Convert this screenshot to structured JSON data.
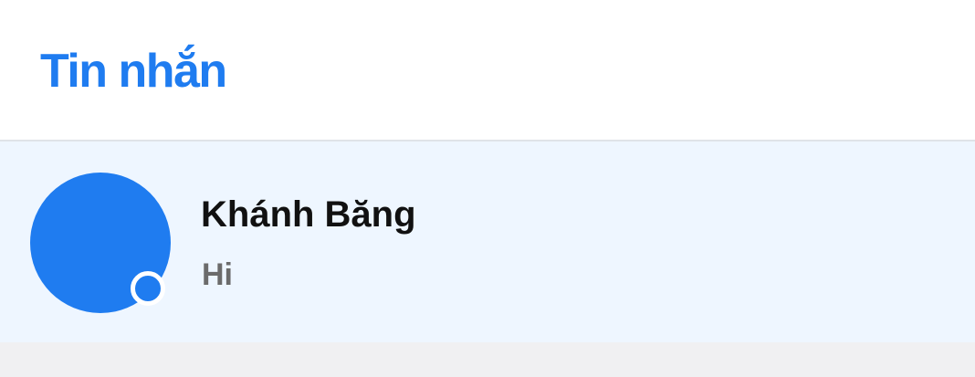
{
  "header": {
    "title": "Tin nhắn"
  },
  "conversations": [
    {
      "name": "Khánh Băng",
      "last_message": "Hi",
      "avatar_color": "#1f7cf0",
      "online": true
    }
  ],
  "colors": {
    "accent": "#1f7cf0",
    "selected_row": "#eef6ff",
    "background": "#ffffff",
    "footer": "#f0f0f2"
  }
}
